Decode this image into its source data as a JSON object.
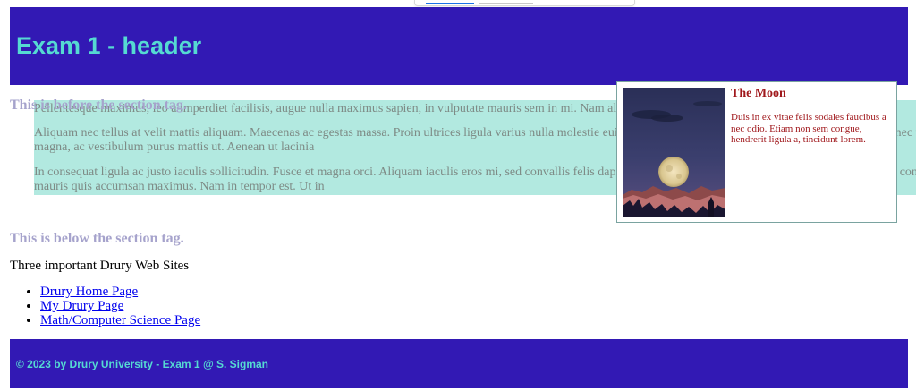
{
  "colors": {
    "header_bg": "#3219b4",
    "header_text": "#55dad2",
    "section_bg": "#b2e9e0",
    "section_text": "#7e8b86",
    "label_text": "#a6a3cc",
    "figure_text": "#a0181c",
    "link": "#0000ee"
  },
  "header": {
    "title": "Exam 1 - header"
  },
  "section": {
    "label": "This is before the section tag.",
    "paragraphs": [
      "Pellentesque maximus, leo a imperdiet facilisis, augue nulla maximus sapien, in vulputate mauris sem in mi. Nam aliquet",
      "Aliquam nec tellus at velit mattis aliquam. Maecenas ac egestas massa. Proin ultrices ligula varius nulla molestie euismod. scelerisque sed justo. Ut varius porta blandit. Donec tempor dui magna, ac vestibulum purus mattis ut. Aenean ut lacinia",
      "In consequat ligula ac justo iaculis sollicitudin. Fusce et magna orci. Aliquam iaculis eros mi, sed convallis felis dapibus sollicitudin arcu, et porta ante lectus id lacus. Nunc convallis mauris quis accumsan maximus. Nam in tempor est. Ut in"
    ]
  },
  "figure": {
    "image_icon": "moon-photo",
    "title": "The Moon",
    "text": "Duis in ex vitae felis sodales faucibus a nec odio. Etiam non sem congue, hendrerit ligula a, tincidunt lorem."
  },
  "below_label": "This is below the section tag.",
  "sites": {
    "title": "Three important Drury Web Sites",
    "links": [
      "Drury Home Page",
      "My Drury Page",
      "Math/Computer Science Page"
    ]
  },
  "footer": {
    "text": "© 2023 by Drury University - Exam 1 @ S. Sigman"
  }
}
